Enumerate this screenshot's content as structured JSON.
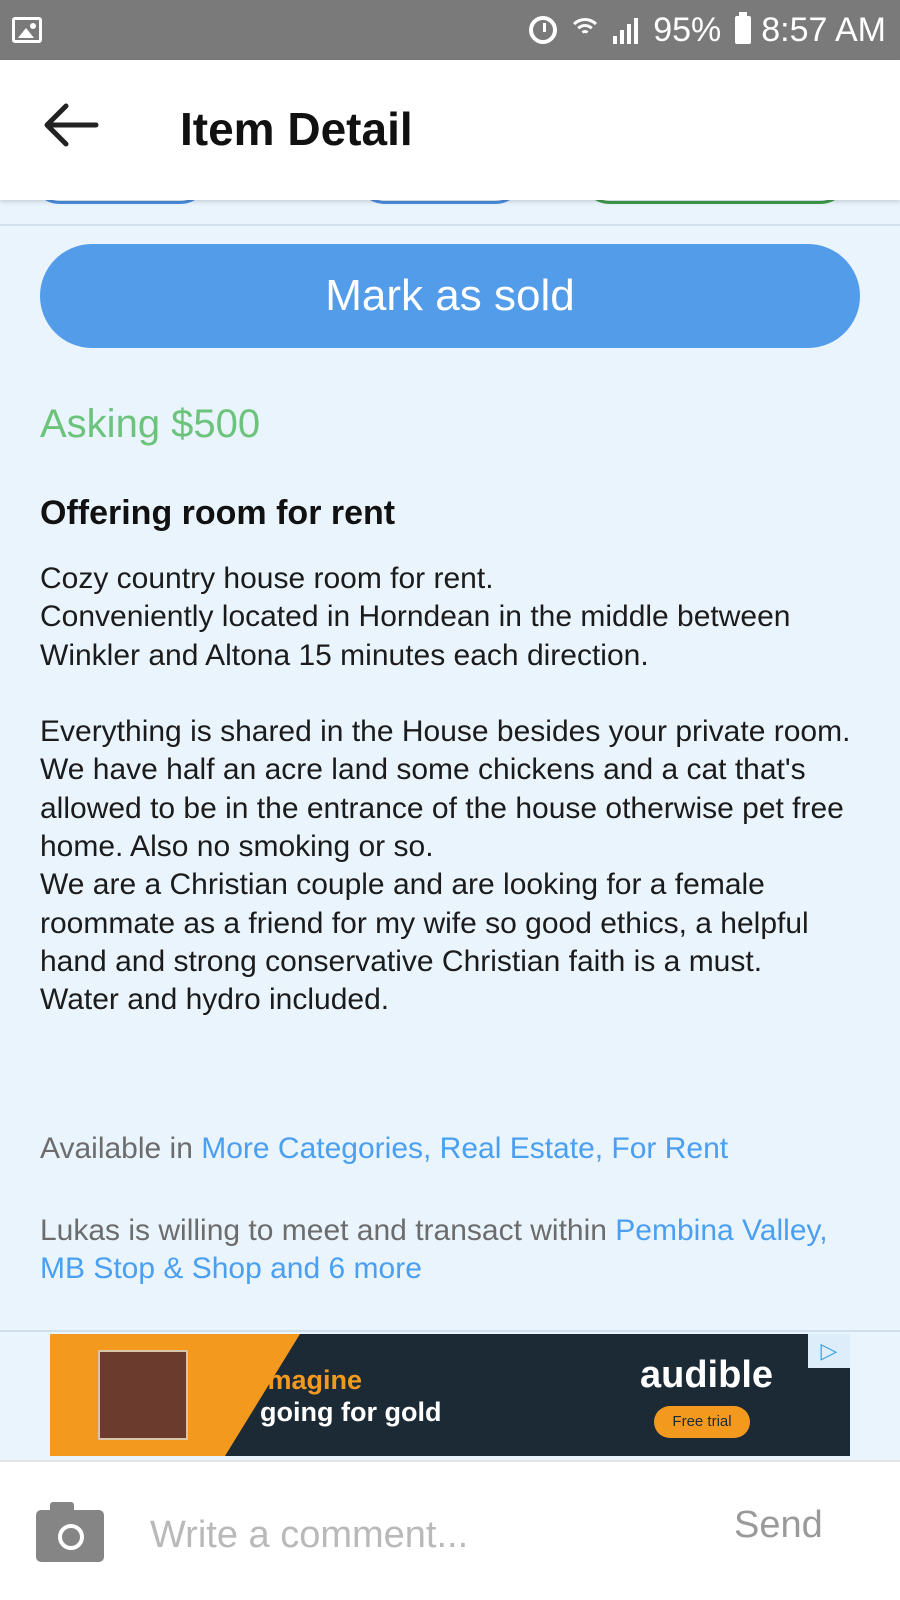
{
  "status_bar": {
    "battery": "95%",
    "time": "8:57 AM"
  },
  "header": {
    "title": "Item Detail"
  },
  "actions": {
    "mark_sold": "Mark as sold"
  },
  "listing": {
    "price": "Asking $500",
    "title": "Offering room for rent",
    "description": "Cozy country house room for rent.\nConveniently located in Horndean in the middle between Winkler and Altona 15 minutes each direction.\n\nEverything is shared in the House besides your private room.\nWe have half an acre land some chickens and a cat that's allowed to be in the entrance of the house otherwise pet free home. Also no smoking or so.\nWe are a Christian couple and are looking for a female roommate as a friend for my wife so good ethics, a helpful hand and strong conservative Christian faith is a must.\nWater and hydro included.",
    "available_prefix": "Available in ",
    "categories": "More Categories, Real Estate, For Rent",
    "meet_prefix": "Lukas is willing to meet and transact within ",
    "meet_locations": "Pembina Valley, MB Stop & Shop and 6 more"
  },
  "ad": {
    "headline_line1": "Imagine",
    "headline_line2": "going for gold",
    "brand": "audible",
    "cta": "Free trial",
    "brand_color": "#f39a1e"
  },
  "comment": {
    "placeholder": "Write a comment...",
    "send": "Send"
  },
  "colors": {
    "accent_blue": "#529cea",
    "price_green": "#6cc47c",
    "link_blue": "#4a9ff0",
    "background": "#eaf4fd"
  }
}
